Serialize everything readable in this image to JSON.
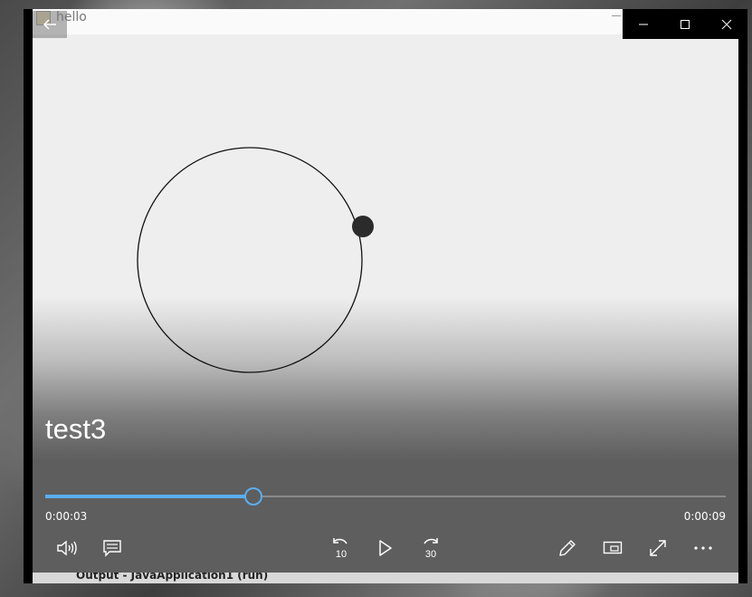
{
  "background_window": {
    "title": "hello",
    "taskbar_text": "Output - JavaApplication1 (run)"
  },
  "titlebar": {
    "back_icon": "back-arrow-icon",
    "minimize_icon": "minimize-icon",
    "maximize_icon": "maximize-icon",
    "close_icon": "close-icon"
  },
  "video": {
    "title": "test3",
    "progress": 0.3058
  },
  "times": {
    "current": "0:00:03",
    "total": "0:00:09"
  },
  "controls": {
    "volume_icon": "volume-icon",
    "captions_icon": "captions-icon",
    "skip_back_label": "10",
    "play_icon": "play-icon",
    "skip_forward_label": "30",
    "edit_icon": "pencil-icon",
    "mini_view_icon": "mini-view-icon",
    "fullscreen_icon": "fullscreen-icon",
    "more_icon": "more-icon"
  },
  "colors": {
    "accent": "#5aaef0",
    "control_bg": "#5e5e5e",
    "video_bg": "#eeeeee"
  }
}
